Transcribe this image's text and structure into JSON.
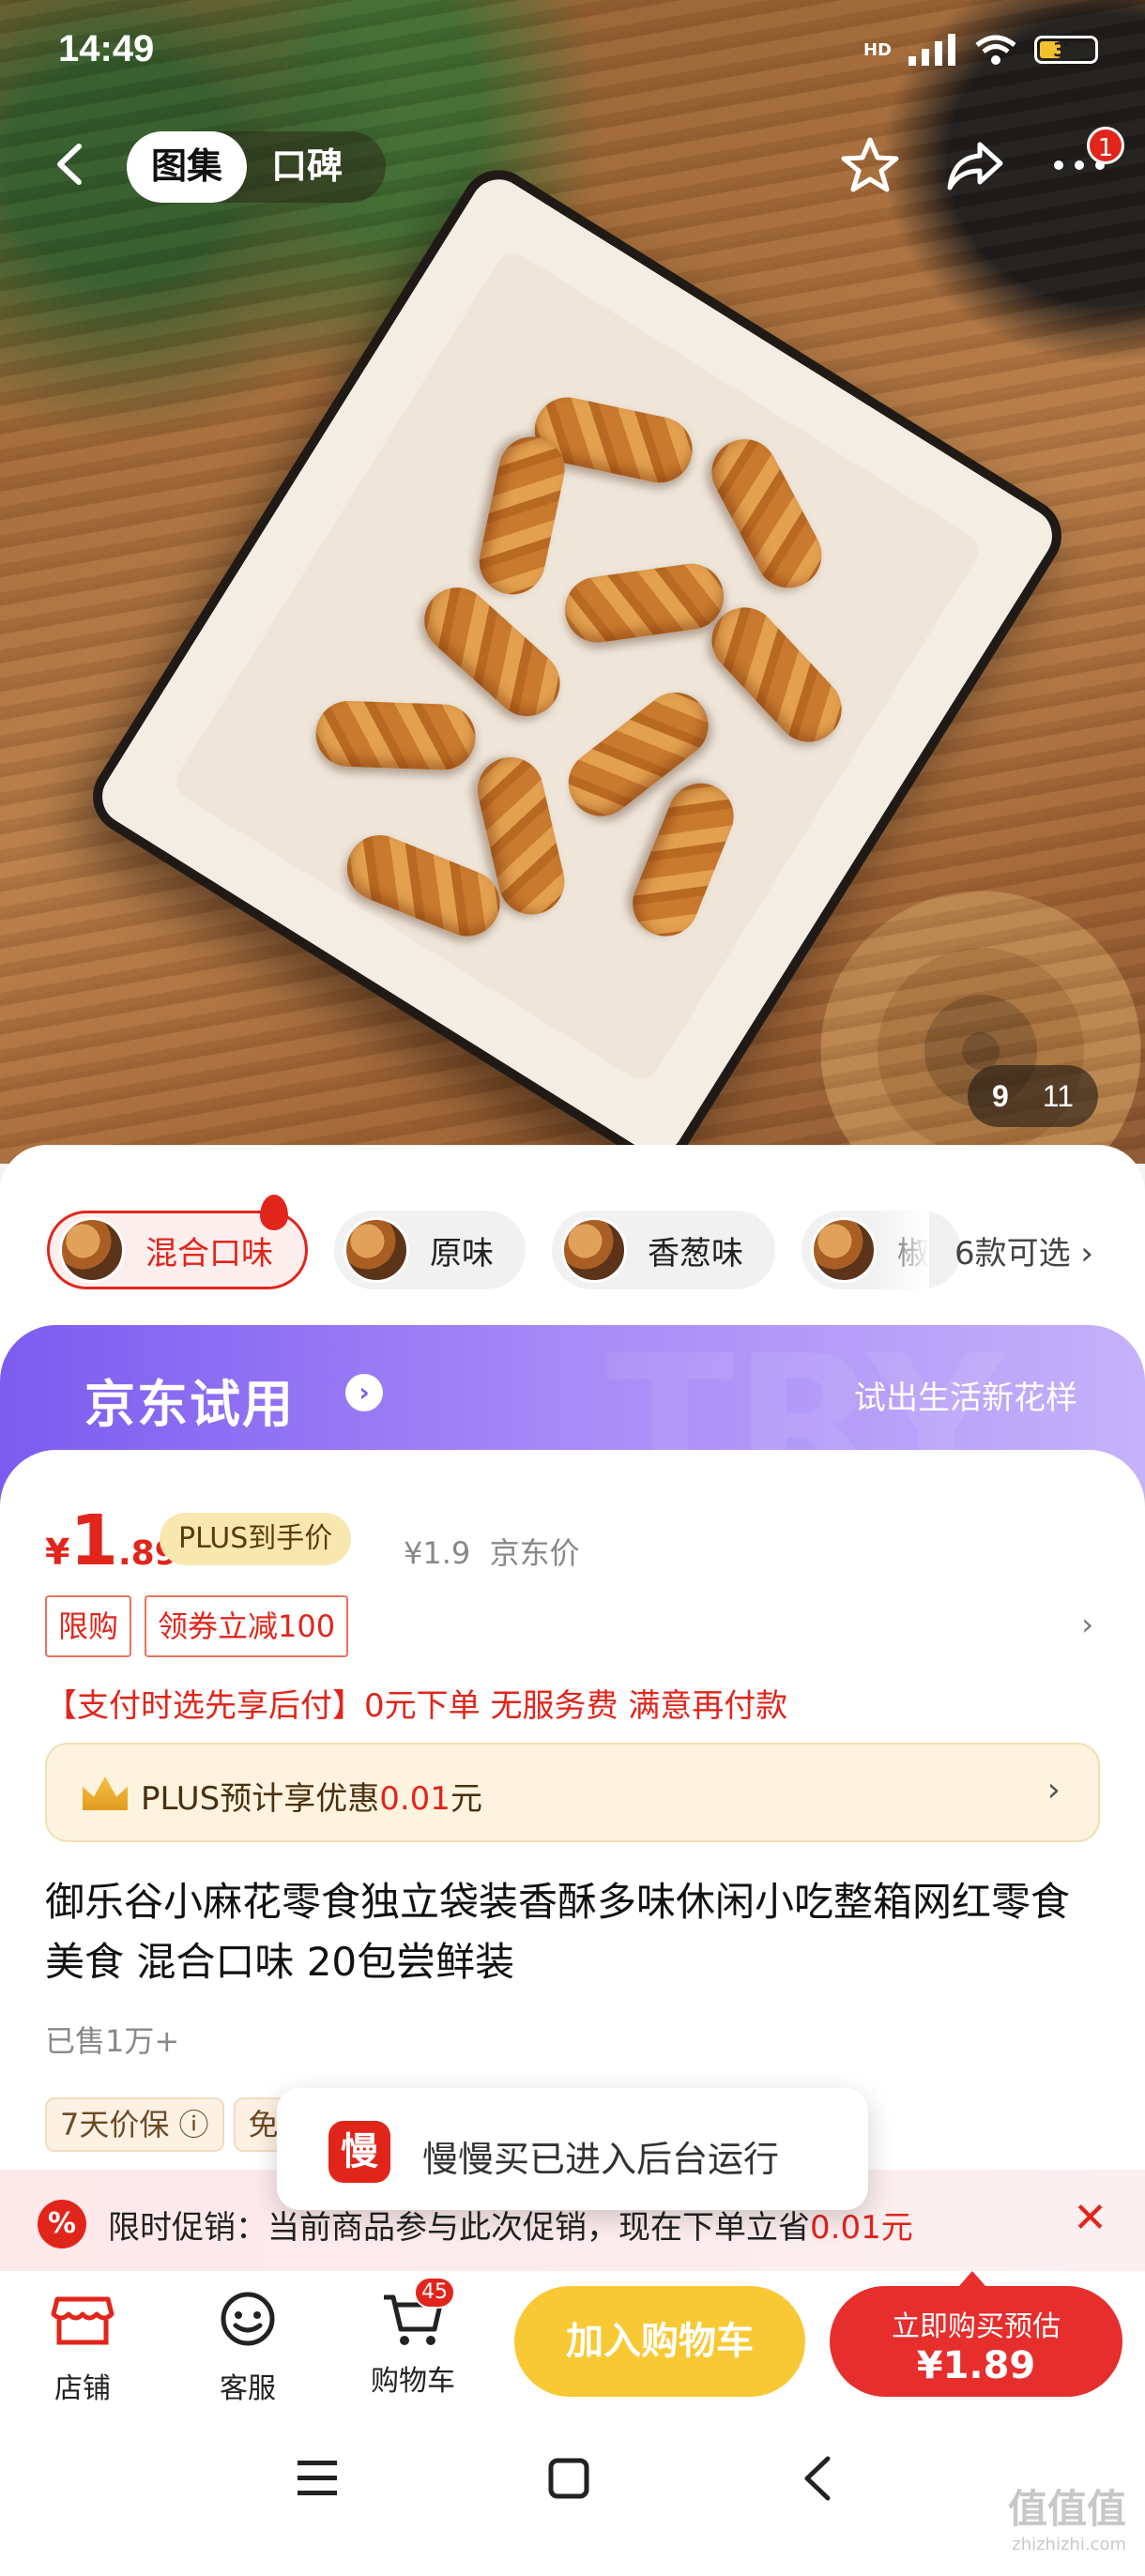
{
  "status_bar": {
    "time": "14:49",
    "network": "HD",
    "battery": "37"
  },
  "header": {
    "tabs": [
      {
        "label": "图集",
        "active": true
      },
      {
        "label": "口碑",
        "active": false
      }
    ],
    "more_badge": "1"
  },
  "gallery": {
    "current": "9",
    "total": "11"
  },
  "variants": {
    "items": [
      {
        "label": "混合口味",
        "active": true
      },
      {
        "label": "原味",
        "active": false
      },
      {
        "label": "香葱味",
        "active": false
      },
      {
        "label": "椒",
        "active": false
      }
    ],
    "more_label": "6款可选"
  },
  "trial": {
    "title": "京东试用",
    "subtitle": "试出生活新花样"
  },
  "price": {
    "currency": "¥",
    "integer": "1",
    "decimal": ".89",
    "plus_tag": "PLUS到手价",
    "jd_price": "¥1.9",
    "jd_price_label": "京东价"
  },
  "coupons": [
    "限购",
    "领券立减100"
  ],
  "pay_later": "【支付时选先享后付】0元下单 无服务费 满意再付款",
  "plus_benefit": {
    "prefix": "PLUS预计享优惠",
    "amount": "0.01",
    "suffix": "元"
  },
  "product_title": "御乐谷小麻花零食独立袋装香酥多味休闲小吃整箱网红零食美食 混合口味 20包尝鲜装",
  "sold": "已售1万+",
  "service_tags": [
    "7天价保 ⓘ",
    "免"
  ],
  "toast": {
    "icon": "慢",
    "text": "慢慢买已进入后台运行"
  },
  "limited_promo": {
    "icon": "%",
    "label": "限时促销：",
    "text": "当前商品参与此次促销，现在下单立省",
    "amount": "0.01元"
  },
  "actions": {
    "shop": "店铺",
    "service": "客服",
    "cart": "购物车",
    "cart_count": "45",
    "add_to_cart": "加入购物车",
    "buy_now": "立即购买预估",
    "buy_price": "¥1.89"
  },
  "watermark": {
    "main": "值值值",
    "sub": "zhizhizhi.com"
  },
  "colors": {
    "accent": "#e1251b",
    "trial": "#7b5cf0",
    "cart_btn": "#f8c934",
    "buy_btn": "#e62e2d"
  }
}
